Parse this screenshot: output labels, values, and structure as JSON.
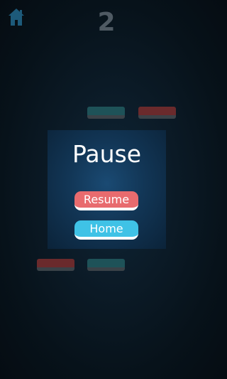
{
  "hud": {
    "home_icon": "home-icon",
    "score": "2"
  },
  "tiles": [
    {
      "color": "teal"
    },
    {
      "color": "red"
    },
    {
      "color": "red"
    },
    {
      "color": "teal"
    }
  ],
  "pause_menu": {
    "title": "Pause",
    "resume_label": "Resume",
    "home_label": "Home"
  },
  "colors": {
    "resume_button": "#e86b6e",
    "home_button": "#3fc2e6",
    "teal_tile": "#1e5258",
    "red_tile": "#6a2a2c",
    "home_icon": "#1d5a7a"
  }
}
